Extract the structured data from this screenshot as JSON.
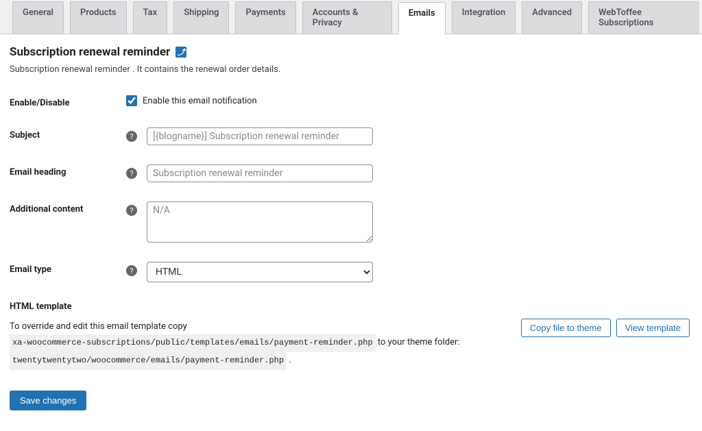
{
  "tabs": {
    "general": "General",
    "products": "Products",
    "tax": "Tax",
    "shipping": "Shipping",
    "payments": "Payments",
    "accounts": "Accounts & Privacy",
    "emails": "Emails",
    "integration": "Integration",
    "advanced": "Advanced",
    "webtoffee": "WebToffee Subscriptions"
  },
  "page": {
    "title": "Subscription renewal reminder",
    "description": "Subscription renewal reminder . It contains the renewal order details."
  },
  "form": {
    "enable_label": "Enable/Disable",
    "enable_checkbox_label": "Enable this email notification",
    "subject_label": "Subject",
    "subject_placeholder": "[{blogname}] Subscription renewal reminder",
    "heading_label": "Email heading",
    "heading_placeholder": "Subscription renewal reminder",
    "additional_label": "Additional content",
    "additional_placeholder": "N/A",
    "emailtype_label": "Email type",
    "emailtype_value": "HTML"
  },
  "template": {
    "heading": "HTML template",
    "text_before": "To override and edit this email template copy ",
    "path_source": "xa-woocommerce-subscriptions/public/templates/emails/payment-reminder.php",
    "text_middle": " to your theme folder: ",
    "path_dest": "twentytwentytwo/woocommerce/emails/payment-reminder.php",
    "text_after": " .",
    "copy_button": "Copy file to theme",
    "view_button": "View template"
  },
  "save_button": "Save changes"
}
